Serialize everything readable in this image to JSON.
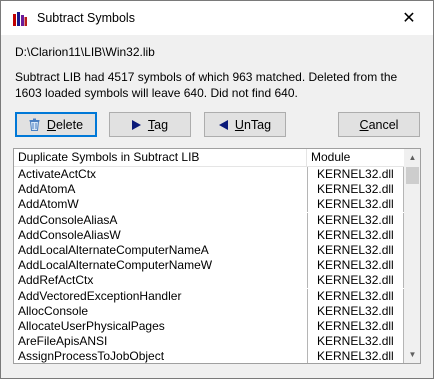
{
  "window": {
    "title": "Subtract Symbols",
    "close_glyph": "✕"
  },
  "path": "D:\\Clarion11\\LIB\\Win32.lib",
  "message": "Subtract LIB had 4517 symbols of which 963 matched. Deleted from the 1603 loaded symbols will leave 640. Did not find 640.",
  "buttons": {
    "delete": {
      "pre": "",
      "u": "D",
      "post": "elete",
      "icon": "trash-icon"
    },
    "tag": {
      "pre": "",
      "u": "T",
      "post": "ag",
      "icon": "play-right-icon"
    },
    "untag": {
      "pre": "",
      "u": "U",
      "post": "nTag",
      "icon": "play-left-icon"
    },
    "cancel": {
      "pre": "",
      "u": "C",
      "post": "ancel"
    }
  },
  "table": {
    "columns": [
      "Duplicate Symbols in Subtract LIB",
      "Module"
    ],
    "rows": [
      [
        "ActivateActCtx",
        "KERNEL32.dll"
      ],
      [
        "AddAtomA",
        "KERNEL32.dll"
      ],
      [
        "AddAtomW",
        "KERNEL32.dll"
      ],
      [
        "AddConsoleAliasA",
        "KERNEL32.dll"
      ],
      [
        "AddConsoleAliasW",
        "KERNEL32.dll"
      ],
      [
        "AddLocalAlternateComputerNameA",
        "KERNEL32.dll"
      ],
      [
        "AddLocalAlternateComputerNameW",
        "KERNEL32.dll"
      ],
      [
        "AddRefActCtx",
        "KERNEL32.dll"
      ],
      [
        "AddVectoredExceptionHandler",
        "KERNEL32.dll"
      ],
      [
        "AllocConsole",
        "KERNEL32.dll"
      ],
      [
        "AllocateUserPhysicalPages",
        "KERNEL32.dll"
      ],
      [
        "AreFileApisANSI",
        "KERNEL32.dll"
      ],
      [
        "AssignProcessToJobObject",
        "KERNEL32.dll"
      ]
    ]
  },
  "colors": {
    "accent": "#0078d7",
    "button_bg": "#e1e1e1",
    "dialog_bg": "#f0f0f0"
  }
}
